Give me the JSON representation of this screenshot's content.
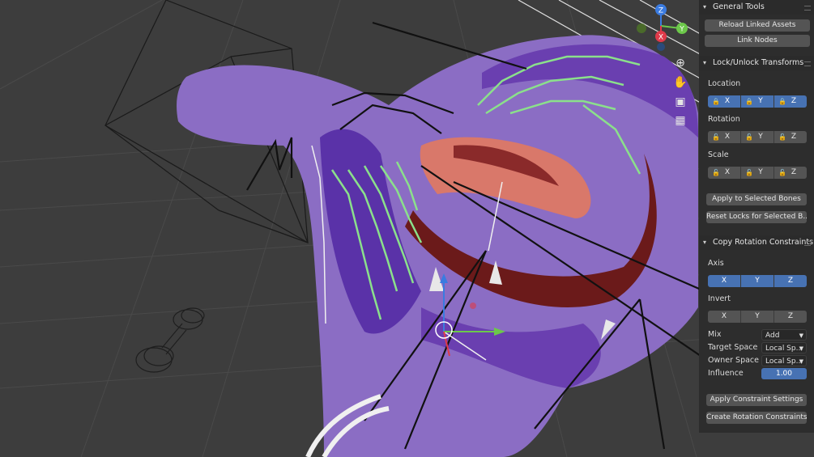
{
  "viewport": {
    "colors": {
      "background": "#3d3d3d",
      "mesh_purple": "#8b6dc4",
      "mesh_dark_purple": "#6a3fb0",
      "bone_green": "#8be08b",
      "mouth_red": "#6b1a1a",
      "tongue": "#d9786a"
    },
    "nav_icons": [
      "zoom-icon",
      "hand-pan-icon",
      "camera-icon",
      "grid-view-icon"
    ],
    "gizmo": {
      "x_label": "X",
      "y_label": "Y",
      "z_label": "Z"
    }
  },
  "panel": {
    "general_tools": {
      "title": "General Tools",
      "reload_label": "Reload Linked Assets",
      "link_nodes_label": "Link Nodes"
    },
    "lock_transforms": {
      "title": "Lock/Unlock Transforms",
      "location_label": "Location",
      "rotation_label": "Rotation",
      "scale_label": "Scale",
      "axis_x": "X",
      "axis_y": "Y",
      "axis_z": "Z",
      "apply_label": "Apply to Selected Bones",
      "reset_label": "Reset Locks for Selected B..."
    },
    "copy_rotation": {
      "title": "Copy Rotation Constraints",
      "axis_label": "Axis",
      "invert_label": "Invert",
      "axis_x": "X",
      "axis_y": "Y",
      "axis_z": "Z",
      "mix_label": "Mix",
      "mix_value": "Add",
      "target_space_label": "Target Space",
      "target_space_value": "Local Sp...",
      "owner_space_label": "Owner Space",
      "owner_space_value": "Local Sp...",
      "influence_label": "Influence",
      "influence_value": "1.00",
      "apply_settings_label": "Apply Constraint Settings",
      "create_label": "Create Rotation Constraints"
    }
  }
}
